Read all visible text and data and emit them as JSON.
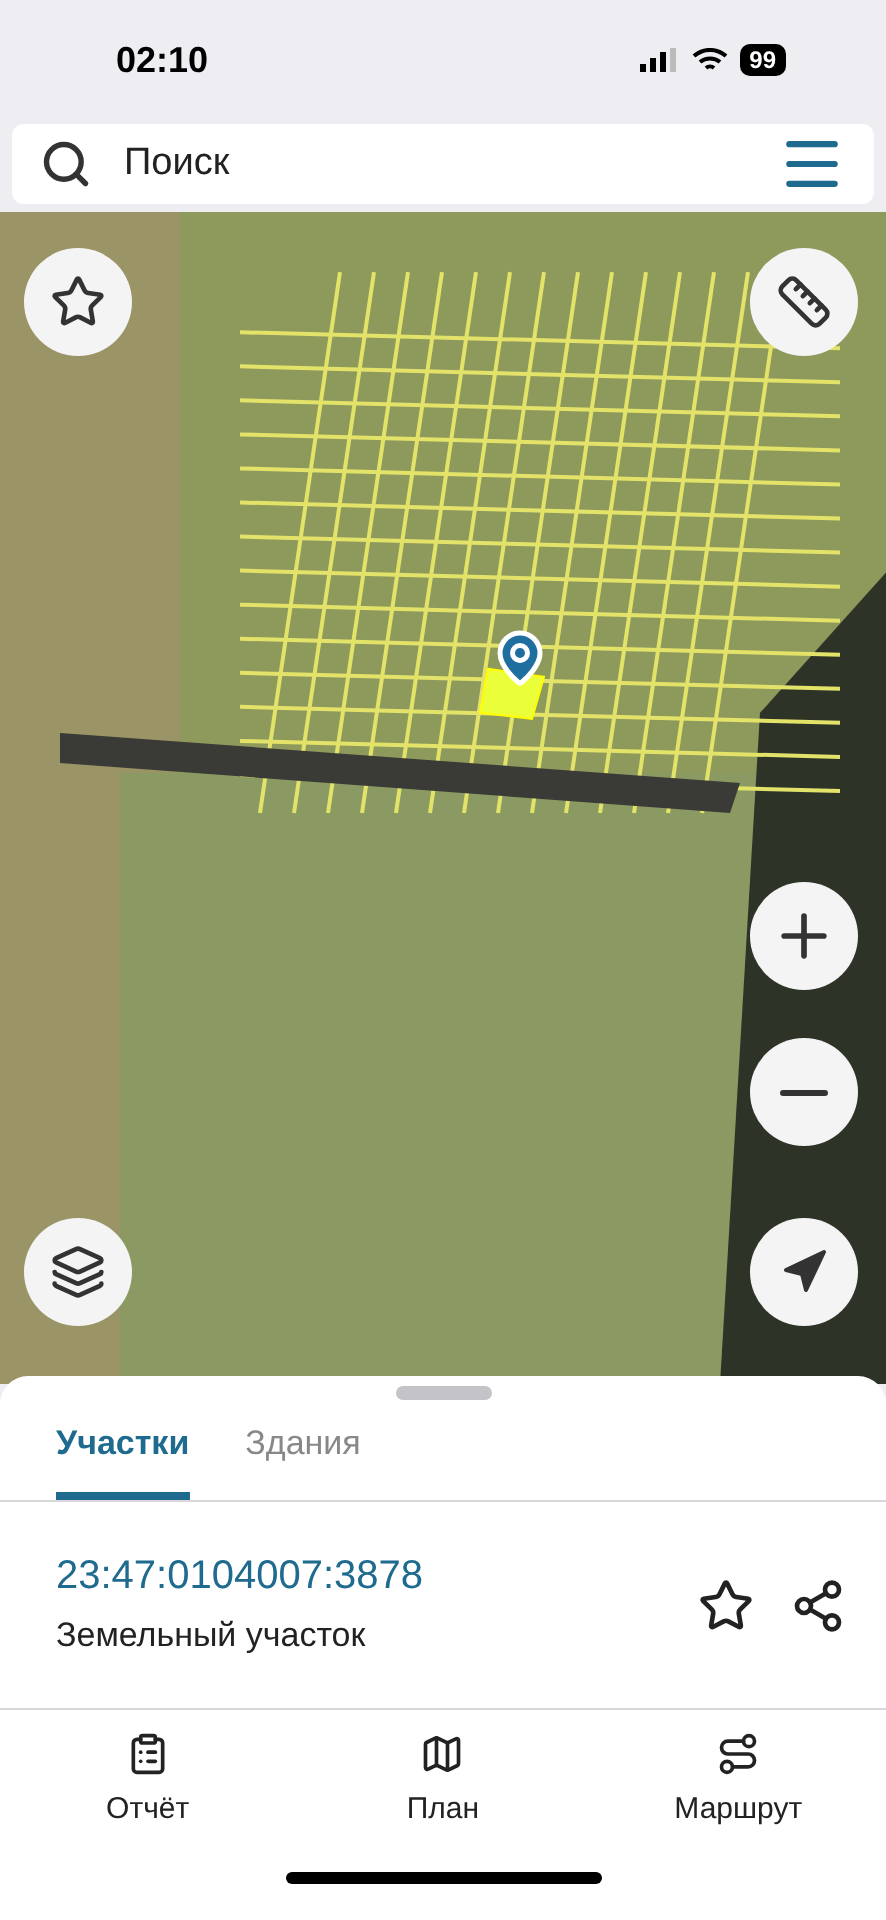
{
  "status_bar": {
    "time": "02:10",
    "battery": "99"
  },
  "search": {
    "placeholder": "Поиск"
  },
  "tabs": [
    {
      "label": "Участки",
      "selected": true
    },
    {
      "label": "Здания",
      "selected": false
    }
  ],
  "parcel": {
    "number": "23:47:0104007:3878",
    "type": "Земельный участок"
  },
  "nav": [
    {
      "kind": "report",
      "label": "Отчёт"
    },
    {
      "kind": "plan",
      "label": "План"
    },
    {
      "kind": "route",
      "label": "Маршрут"
    }
  ]
}
